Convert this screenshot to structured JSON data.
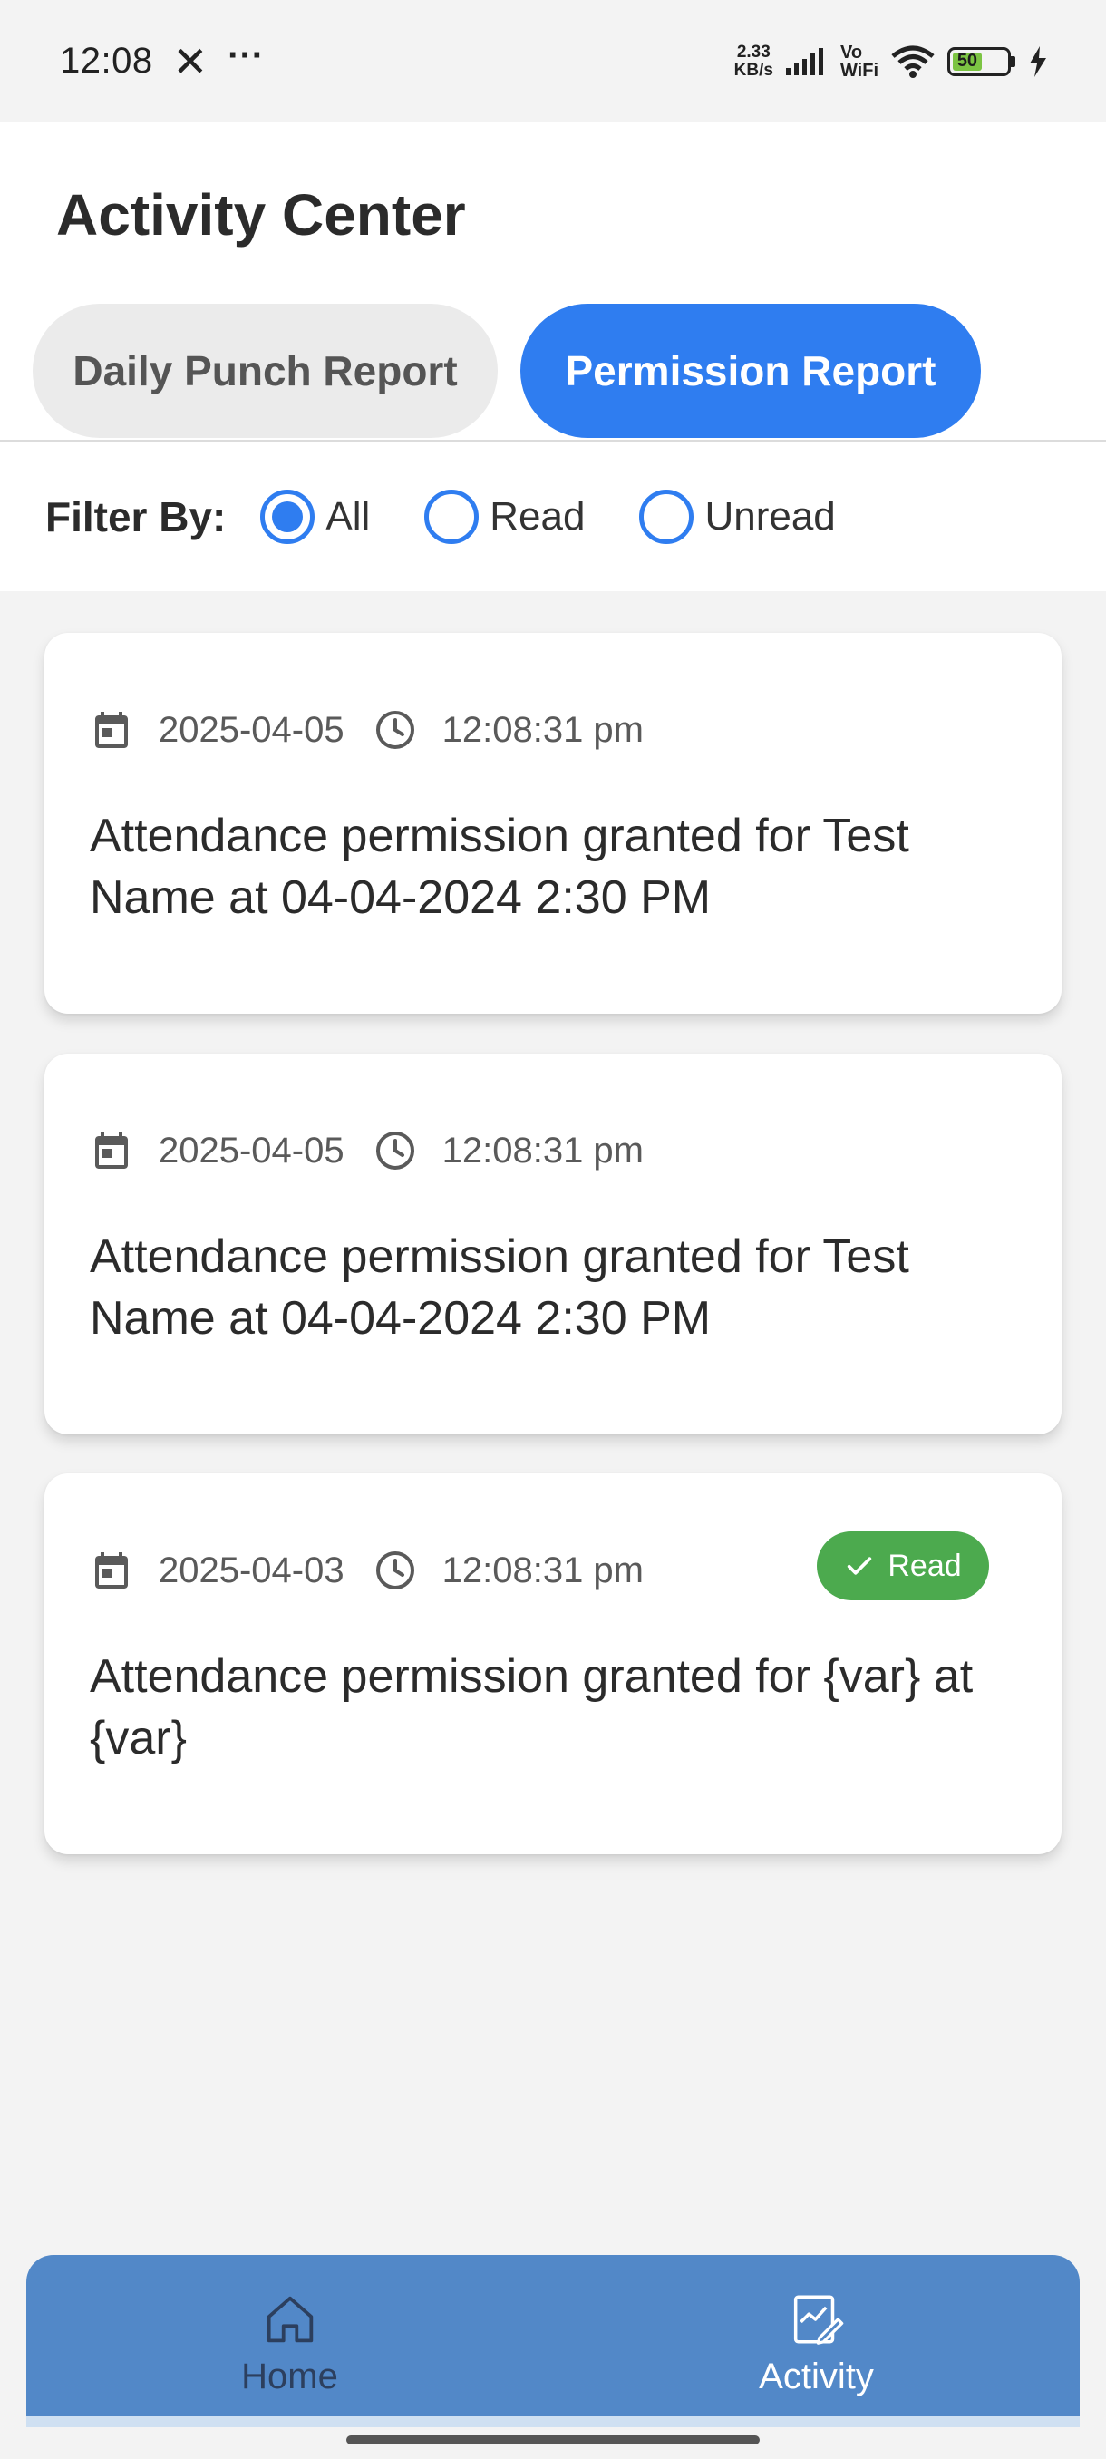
{
  "status_bar": {
    "time": "12:08",
    "close_glyph": "✕",
    "more_glyph": "···",
    "speed_value": "2.33",
    "speed_unit": "KB/s",
    "vo": "Vo",
    "wifi_label": "WiFi",
    "battery": "50"
  },
  "header": {
    "title": "Activity Center",
    "tabs": [
      {
        "label": "Daily Punch Report",
        "active": false
      },
      {
        "label": "Permission Report",
        "active": true
      }
    ]
  },
  "filter": {
    "label": "Filter By:",
    "options": [
      {
        "label": "All",
        "selected": true
      },
      {
        "label": "Read",
        "selected": false
      },
      {
        "label": "Unread",
        "selected": false
      }
    ]
  },
  "cards": [
    {
      "date": "2025-04-05",
      "time": "12:08:31 pm",
      "message": "Attendance permission granted for Test Name at 04-04-2024 2:30 PM",
      "badge": null
    },
    {
      "date": "2025-04-05",
      "time": "12:08:31 pm",
      "message": "Attendance permission granted for Test Name at 04-04-2024 2:30 PM",
      "badge": null
    },
    {
      "date": "2025-04-03",
      "time": "12:08:31 pm",
      "message": "Attendance permission granted for {var} at {var}",
      "badge": "Read"
    }
  ],
  "bottom_nav": {
    "items": [
      {
        "label": "Home",
        "icon": "home-icon"
      },
      {
        "label": "Activity",
        "icon": "activity-icon"
      }
    ]
  },
  "colors": {
    "accent": "#2f7df0",
    "nav_background": "#5288c8",
    "read_badge": "#4caa4e"
  }
}
